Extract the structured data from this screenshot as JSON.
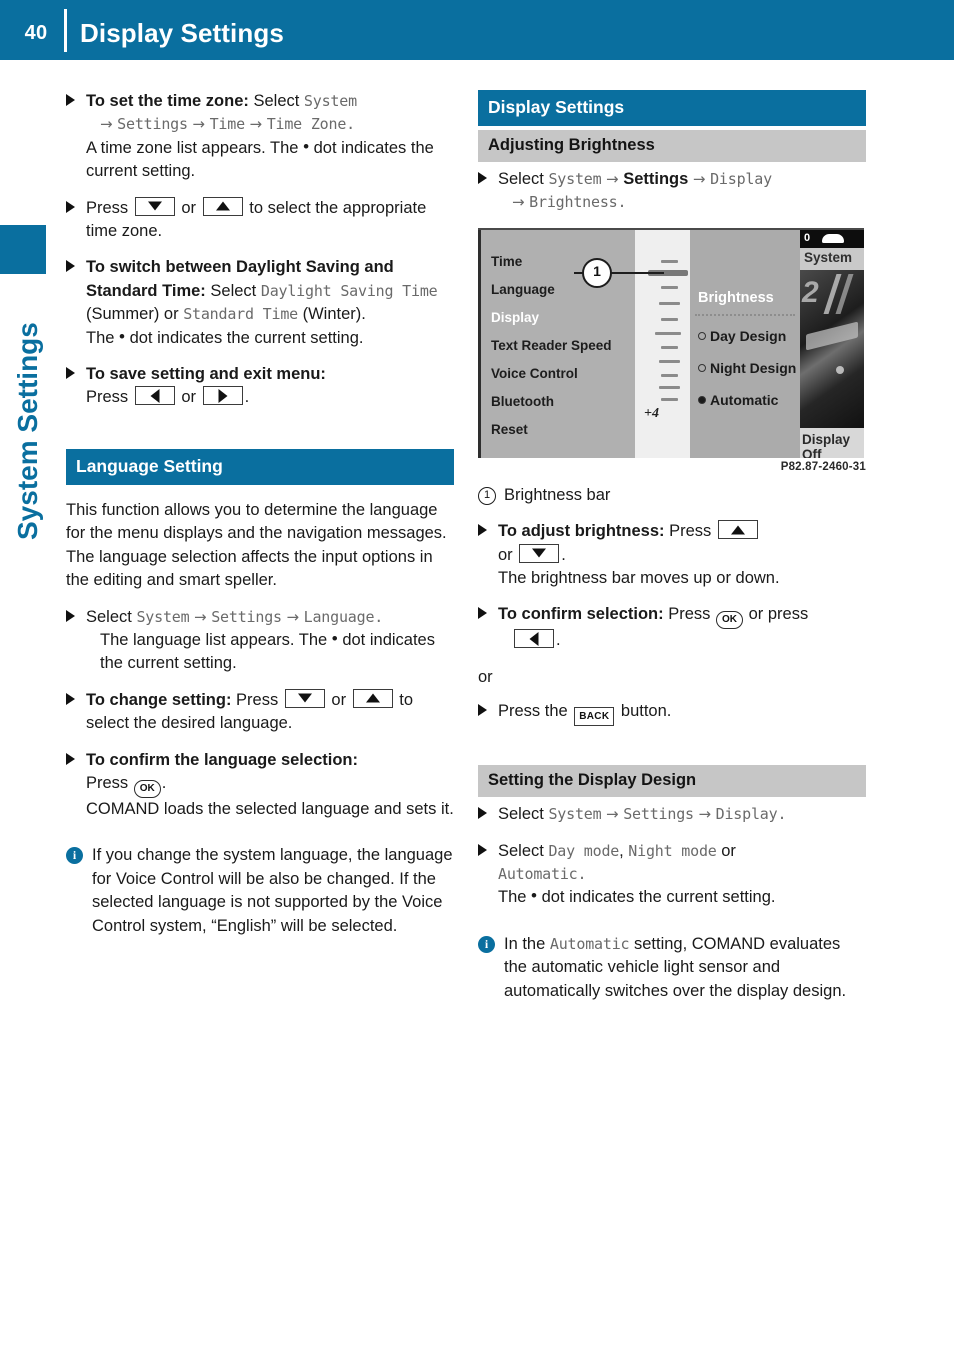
{
  "header": {
    "page_number": "40",
    "title": "Display Settings",
    "accent_color": "#0a6f9f"
  },
  "side_tab": {
    "label": "System Settings"
  },
  "left_column": {
    "items": [
      {
        "bold_lead": "To set the time zone:",
        "text_1": "Select",
        "mono_1": "System",
        "arrow_1": "→",
        "mono_2": "Settings",
        "arrow_2": "→",
        "mono_3": "Time",
        "arrow_3": "→",
        "mono_4": "Time Zone",
        "tail": ".",
        "sub_1": "A time zone list appears. The",
        "sub_dot": "•",
        "sub_2": "dot",
        "sub_3": "indicates the current setting."
      },
      {
        "text_1": "Press",
        "key_1": "down-arrow-key",
        "text_2": "or",
        "key_2": "up-arrow-key",
        "text_3": "to select the appropriate time zone."
      },
      {
        "bold_lead": "To switch between Daylight Saving and Standard Time:",
        "text_1": "Select",
        "mono_1": "Daylight Saving Time",
        "text_2": "(Summer) or",
        "mono_2": "Standard Time",
        "text_3": "(Winter).",
        "sub_1": "The",
        "sub_dot": "•",
        "sub_2": "dot indicates the current setting."
      },
      {
        "bold_lead": "To save setting and exit menu:",
        "text_1": "Press",
        "key_1": "left-arrow-key",
        "text_2": "or",
        "key_2": "right-arrow-key",
        "tail": "."
      }
    ],
    "section_heading": "Language Setting",
    "intro": "This function allows you to determine the language for the menu displays and the navigation messages. The language selection affects the input options in the editing and smart speller.",
    "items2": [
      {
        "text_1": "Select",
        "mono_1": "System",
        "arrow_1": "→",
        "mono_2": "Settings",
        "arrow_2": "→",
        "mono_3": "Language",
        "tail": ".",
        "sub_1": "The language list appears. The",
        "sub_dot": "•",
        "sub_2": "dot",
        "sub_3": "indicates the current setting."
      },
      {
        "bold_lead": "To change setting:",
        "text_1": "Press",
        "key_1": "down-arrow-key",
        "text_2": "or",
        "key_2": "up-arrow-key",
        "text_3": "to select the desired language."
      },
      {
        "bold_lead": "To confirm the language selection:",
        "text_1": "Press",
        "key_ok": "OK",
        "tail": ".",
        "sub_1": "COMAND loads the selected language and sets it."
      }
    ],
    "note": "If you change the system language, the language for Voice Control will be also be changed. If the selected language is not supported by the Voice Control system, “English” will be selected."
  },
  "right_column": {
    "section_heading": "Display Settings",
    "sub_heading_1": "Adjusting Brightness",
    "item_select": {
      "text_1": "Select",
      "mono_1": "System",
      "arrow_1": "→",
      "bold_1": "Settings",
      "arrow_2": "→",
      "mono_2": "Display",
      "arrow_3": "→",
      "mono_3": "Brightness",
      "tail": "."
    },
    "figure": {
      "caption_code": "P82.87-2460-31",
      "callout_number": "1",
      "menu_items": [
        "Time",
        "Language",
        "Display",
        "Text Reader Speed",
        "Voice Control",
        "Bluetooth",
        "Reset"
      ],
      "selected_menu_item": "Display",
      "slot_label": "+4",
      "panel_heading": "Brightness",
      "options": [
        {
          "label": "Day Design",
          "selected": false
        },
        {
          "label": "Night Design",
          "selected": false
        },
        {
          "label": "Automatic",
          "selected": true
        }
      ],
      "status_bar_text": "0",
      "far_panel_title": "System",
      "far_panel_photo_number": "2",
      "far_panel_bottom": "Display Off"
    },
    "legend": {
      "number": "1",
      "label": "Brightness bar"
    },
    "items": [
      {
        "bold_lead": "To adjust brightness:",
        "text_1": "Press",
        "key_1": "up-arrow-key",
        "text_2": "or",
        "key_2": "down-arrow-key",
        "tail": ".",
        "sub_1": "The brightness bar moves up or down."
      },
      {
        "bold_lead": "To confirm selection:",
        "text_1": "Press",
        "key_ok": "OK",
        "text_2": "or press",
        "key_2": "left-arrow-key",
        "tail": "."
      }
    ],
    "or_text": "or",
    "item_back": {
      "text_1": "Press the",
      "key_back": "BACK",
      "text_2": "button."
    },
    "sub_heading_2": "Setting the Display Design",
    "items3": [
      {
        "text_1": "Select",
        "mono_1": "System",
        "arrow_1": "→",
        "mono_2": "Settings",
        "arrow_2": "→",
        "mono_3": "Display",
        "tail": "."
      },
      {
        "text_1": "Select",
        "mono_1": "Day mode",
        "comma": ",",
        "mono_2": "Night mode",
        "text_2": "or",
        "mono_3": "Automatic",
        "tail": ".",
        "sub_1": "The",
        "sub_dot": "•",
        "sub_2": "dot indicates the current setting."
      }
    ],
    "note_lead": "In the",
    "note_mono": "Automatic",
    "note_rest": "setting, COMAND evaluates the automatic vehicle light sensor and automatically switches over the display design."
  }
}
